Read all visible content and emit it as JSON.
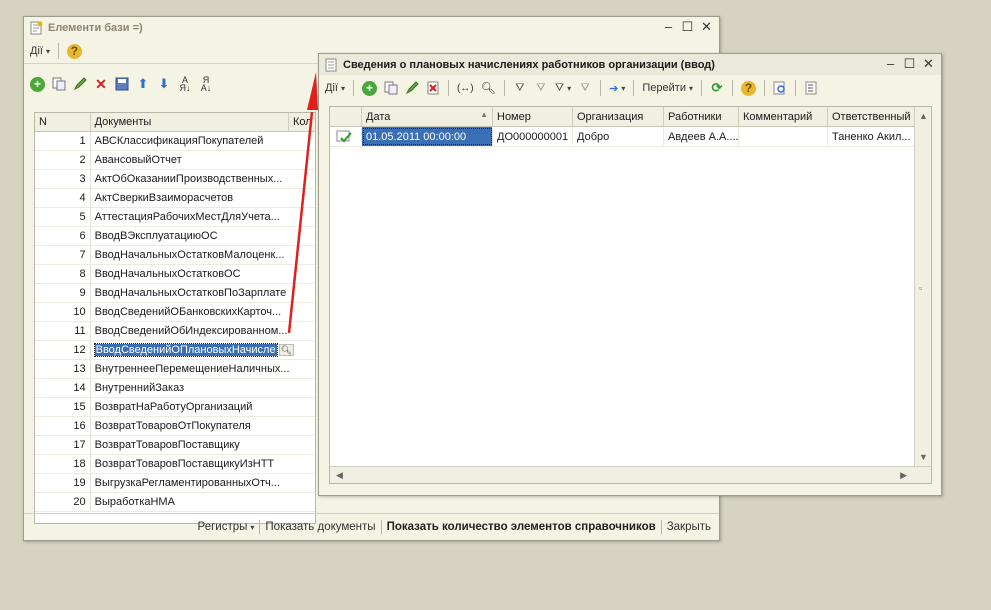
{
  "left_window": {
    "title": "Елементи бази =)",
    "actions_label": "Дії",
    "table": {
      "col_n": "N",
      "col_docs": "Документы",
      "col_kol": "Кол",
      "rows": [
        {
          "n": "1",
          "name": "АВСКлассификацияПокупателей"
        },
        {
          "n": "2",
          "name": "АвансовыйОтчет"
        },
        {
          "n": "3",
          "name": "АктОбОказанииПроизводственных..."
        },
        {
          "n": "4",
          "name": "АктСверкиВзаиморасчетов"
        },
        {
          "n": "5",
          "name": "АттестацияРабочихМестДляУчета..."
        },
        {
          "n": "6",
          "name": "ВводВЭксплуатациюОС"
        },
        {
          "n": "7",
          "name": "ВводНачальныхОстатковМалоценк..."
        },
        {
          "n": "8",
          "name": "ВводНачальныхОстатковОС"
        },
        {
          "n": "9",
          "name": "ВводНачальныхОстатковПоЗарплате"
        },
        {
          "n": "10",
          "name": "ВводСведенийОБанковскихКарточ..."
        },
        {
          "n": "11",
          "name": "ВводСведенийОбИндексированном..."
        },
        {
          "n": "12",
          "name": "ВводСведенийОПлановыхНачисле"
        },
        {
          "n": "13",
          "name": "ВнутреннееПеремещениеНаличных..."
        },
        {
          "n": "14",
          "name": "ВнутреннийЗаказ"
        },
        {
          "n": "15",
          "name": "ВозвратНаРаботуОрганизаций"
        },
        {
          "n": "16",
          "name": "ВозвратТоваровОтПокупателя"
        },
        {
          "n": "17",
          "name": "ВозвратТоваровПоставщику"
        },
        {
          "n": "18",
          "name": "ВозвратТоваровПоставщикуИзНТТ"
        },
        {
          "n": "19",
          "name": "ВыгрузкаРегламентированныхОтч..."
        },
        {
          "n": "20",
          "name": "ВыработкаНМА"
        }
      ]
    },
    "status": {
      "registers": "Регистры",
      "show_docs": "Показать документы",
      "show_count": "Показать количество элементов справочников",
      "close": "Закрыть"
    }
  },
  "right_window": {
    "title": "Сведения о плановых начислениях работников организации (ввод)",
    "actions_label": "Дії",
    "goto_label": "Перейти",
    "columns": [
      "Дата",
      "Номер",
      "Организация",
      "Работники",
      "Комментарий",
      "Ответственный"
    ],
    "rows": [
      {
        "date": "01.05.2011 00:00:00",
        "number": "ДО000000001",
        "org": "Добро",
        "workers": "Авдеев А.А....",
        "comment": "",
        "responsible": "Таненко Акил..."
      }
    ]
  },
  "colors": {
    "selection": "#3a6fb5",
    "arrow": "#e0201a"
  }
}
